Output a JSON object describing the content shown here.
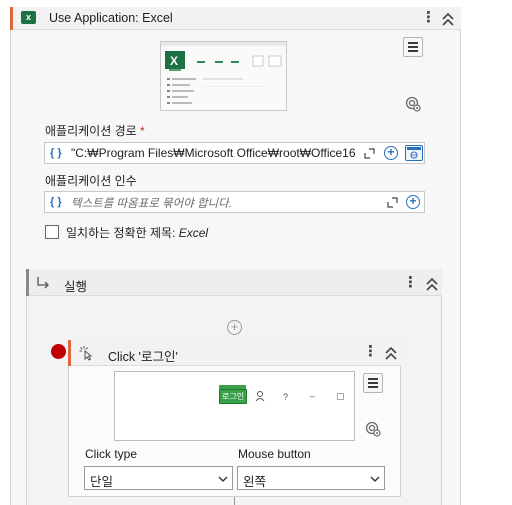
{
  "use_app": {
    "title": "Use Application: Excel",
    "icon": "excel-icon",
    "preview": {
      "logo": "X"
    }
  },
  "app_path": {
    "label": "애플리케이션 경로",
    "required_mark": "*",
    "value": "\"C:₩Program Files₩Microsoft Office₩root₩Office16₩",
    "brace": "{ }"
  },
  "app_args": {
    "label": "애플리케이션 인수",
    "placeholder": "텍스트를 따옴표로 묶어야 합니다.",
    "brace": "{ }"
  },
  "exact_title": {
    "label": "일치하는 정확한 제목:",
    "value": "Excel",
    "checked": false
  },
  "do_block": {
    "title": "실행",
    "icon": "do-branch-icon"
  },
  "click": {
    "title": "Click '로그인'",
    "icon": "click-icon",
    "breakpoint_color": "#c00000",
    "preview": {
      "chip": "로그인",
      "glyph_help": "?",
      "glyph_min": "–",
      "glyph_max": "▢"
    },
    "click_type": {
      "label": "Click type",
      "value": "단일"
    },
    "mouse_button": {
      "label": "Mouse button",
      "value": "왼쪽"
    }
  },
  "colors": {
    "accent": "#e0663b",
    "link_blue": "#2a6ebb",
    "excel_green": "#1e7145"
  }
}
